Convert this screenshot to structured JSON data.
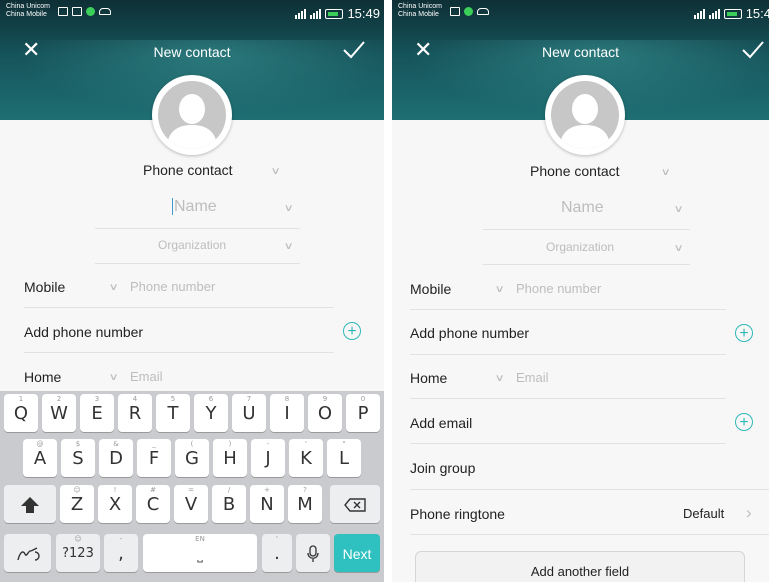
{
  "status": {
    "carrier1": "China Unicom",
    "carrier2": "China Mobile",
    "time_left": "15:49",
    "time_right": "15:4",
    "network_a": "3G",
    "network_b": "2G"
  },
  "header": {
    "title": "New contact"
  },
  "contact": {
    "account": "Phone contact",
    "name_placeholder": "Name",
    "org_placeholder": "Organization"
  },
  "phone": {
    "type_label": "Mobile",
    "placeholder": "Phone number",
    "add_label": "Add phone number"
  },
  "email": {
    "type_label": "Home",
    "placeholder": "Email",
    "add_label": "Add email"
  },
  "group": {
    "label": "Join group"
  },
  "ringtone": {
    "label": "Phone ringtone",
    "value": "Default"
  },
  "add_field": {
    "label": "Add another field"
  },
  "keyboard": {
    "row1": [
      {
        "k": "Q",
        "h": "1"
      },
      {
        "k": "W",
        "h": "2"
      },
      {
        "k": "E",
        "h": "3"
      },
      {
        "k": "R",
        "h": "4"
      },
      {
        "k": "T",
        "h": "5"
      },
      {
        "k": "Y",
        "h": "6"
      },
      {
        "k": "U",
        "h": "7"
      },
      {
        "k": "I",
        "h": "8"
      },
      {
        "k": "O",
        "h": "9"
      },
      {
        "k": "P",
        "h": "0"
      }
    ],
    "row2": [
      {
        "k": "A",
        "h": "@"
      },
      {
        "k": "S",
        "h": "$"
      },
      {
        "k": "D",
        "h": "&"
      },
      {
        "k": "F",
        "h": "_"
      },
      {
        "k": "G",
        "h": "("
      },
      {
        "k": "H",
        "h": ")"
      },
      {
        "k": "J",
        "h": "-"
      },
      {
        "k": "K",
        "h": "'"
      },
      {
        "k": "L",
        "h": "\""
      }
    ],
    "row3": [
      {
        "k": "Z",
        "h": "☺"
      },
      {
        "k": "X",
        "h": "!"
      },
      {
        "k": "C",
        "h": "#"
      },
      {
        "k": "V",
        "h": "="
      },
      {
        "k": "B",
        "h": "/"
      },
      {
        "k": "N",
        "h": "+"
      },
      {
        "k": "M",
        "h": "?"
      }
    ],
    "symbols_label": "?123",
    "comma": ",",
    "space_hint": "EN",
    "period": ".",
    "next_label": "Next",
    "colors": {
      "accent": "#2fc0c0",
      "header_dark": "#0e2f35",
      "header_light": "#1e6f73"
    }
  }
}
